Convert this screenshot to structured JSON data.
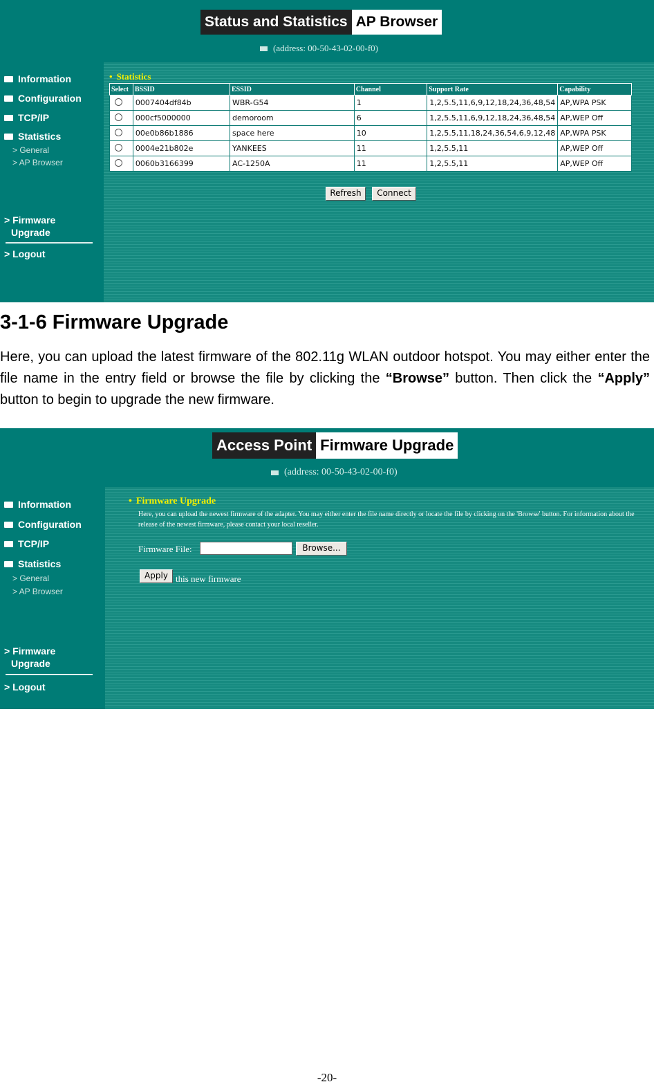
{
  "panel1": {
    "title_dark": "Status and Statistics",
    "title_light": "AP Browser",
    "address": "(address: 00-50-43-02-00-f0)",
    "nav": {
      "information": "Information",
      "configuration": "Configuration",
      "tcpip": "TCP/IP",
      "statistics": "Statistics",
      "general": "> General",
      "ap_browser": "> AP Browser",
      "firmware_1": "> Firmware",
      "firmware_2": "Upgrade",
      "logout": "> Logout"
    },
    "section": "Statistics",
    "table": {
      "headers": [
        "Select",
        "BSSID",
        "ESSID",
        "Channel",
        "Support Rate",
        "Capability"
      ],
      "rows": [
        {
          "bssid": "0007404df84b",
          "essid": "WBR-G54",
          "channel": "1",
          "rate": "1,2,5.5,11,6,9,12,18,24,36,48,54",
          "capability": "AP,WPA PSK"
        },
        {
          "bssid": "000cf5000000",
          "essid": "demoroom",
          "channel": "6",
          "rate": "1,2,5.5,11,6,9,12,18,24,36,48,54",
          "capability": "AP,WEP Off"
        },
        {
          "bssid": "00e0b86b1886",
          "essid": "space here",
          "channel": "10",
          "rate": "1,2,5.5,11,18,24,36,54,6,9,12,48",
          "capability": "AP,WPA PSK"
        },
        {
          "bssid": "0004e21b802e",
          "essid": "YANKEES",
          "channel": "11",
          "rate": "1,2,5.5,11",
          "capability": "AP,WEP Off"
        },
        {
          "bssid": "0060b3166399",
          "essid": "AC-1250A",
          "channel": "11",
          "rate": "1,2,5.5,11",
          "capability": "AP,WEP Off"
        }
      ]
    },
    "refresh_label": "Refresh",
    "connect_label": "Connect"
  },
  "doc": {
    "heading": "3-1-6 Firmware Upgrade",
    "para_1": "Here, you can upload the latest firmware of the 802.11g WLAN outdoor hotspot. You may either enter the file name in the entry field or browse the file by clicking the ",
    "browse_word": "“Browse”",
    "para_2": " button. Then click the ",
    "apply_word": "“Apply”",
    "para_3": " button to begin to upgrade the new firmware.",
    "page_number": "-20-"
  },
  "panel2": {
    "title_dark": "Access Point",
    "title_light": "Firmware Upgrade",
    "address": "(address: 00-50-43-02-00-f0)",
    "nav": {
      "information": "Information",
      "configuration": "Configuration",
      "tcpip": "TCP/IP",
      "statistics": "Statistics",
      "general": "> General",
      "ap_browser": "> AP Browser",
      "firmware_1": "> Firmware",
      "firmware_2": "Upgrade",
      "logout": "> Logout"
    },
    "section": "Firmware Upgrade",
    "description": "Here, you can upload the newest firmware of the adapter. You may either enter the file name directly or locate the file by clicking on the 'Browse' button. For information about the release of the newest firmware, please contact your local reseller.",
    "file_label": "Firmware File:",
    "file_value": "",
    "browse_label": "Browse...",
    "apply_label": "Apply",
    "apply_text": "this new firmware"
  }
}
